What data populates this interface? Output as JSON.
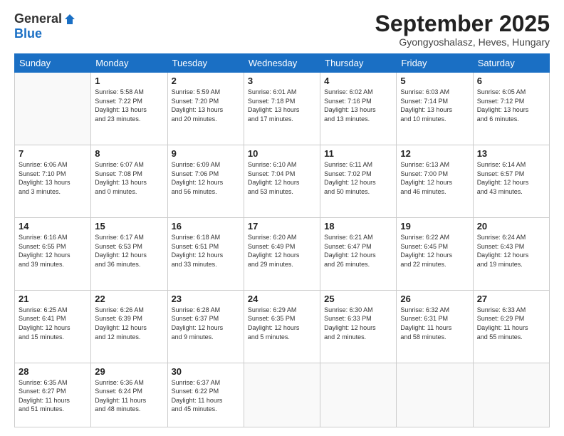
{
  "logo": {
    "general": "General",
    "blue": "Blue"
  },
  "header": {
    "month": "September 2025",
    "location": "Gyongyoshalasz, Heves, Hungary"
  },
  "days_of_week": [
    "Sunday",
    "Monday",
    "Tuesday",
    "Wednesday",
    "Thursday",
    "Friday",
    "Saturday"
  ],
  "weeks": [
    [
      {
        "day": "",
        "info": ""
      },
      {
        "day": "1",
        "info": "Sunrise: 5:58 AM\nSunset: 7:22 PM\nDaylight: 13 hours\nand 23 minutes."
      },
      {
        "day": "2",
        "info": "Sunrise: 5:59 AM\nSunset: 7:20 PM\nDaylight: 13 hours\nand 20 minutes."
      },
      {
        "day": "3",
        "info": "Sunrise: 6:01 AM\nSunset: 7:18 PM\nDaylight: 13 hours\nand 17 minutes."
      },
      {
        "day": "4",
        "info": "Sunrise: 6:02 AM\nSunset: 7:16 PM\nDaylight: 13 hours\nand 13 minutes."
      },
      {
        "day": "5",
        "info": "Sunrise: 6:03 AM\nSunset: 7:14 PM\nDaylight: 13 hours\nand 10 minutes."
      },
      {
        "day": "6",
        "info": "Sunrise: 6:05 AM\nSunset: 7:12 PM\nDaylight: 13 hours\nand 6 minutes."
      }
    ],
    [
      {
        "day": "7",
        "info": "Sunrise: 6:06 AM\nSunset: 7:10 PM\nDaylight: 13 hours\nand 3 minutes."
      },
      {
        "day": "8",
        "info": "Sunrise: 6:07 AM\nSunset: 7:08 PM\nDaylight: 13 hours\nand 0 minutes."
      },
      {
        "day": "9",
        "info": "Sunrise: 6:09 AM\nSunset: 7:06 PM\nDaylight: 12 hours\nand 56 minutes."
      },
      {
        "day": "10",
        "info": "Sunrise: 6:10 AM\nSunset: 7:04 PM\nDaylight: 12 hours\nand 53 minutes."
      },
      {
        "day": "11",
        "info": "Sunrise: 6:11 AM\nSunset: 7:02 PM\nDaylight: 12 hours\nand 50 minutes."
      },
      {
        "day": "12",
        "info": "Sunrise: 6:13 AM\nSunset: 7:00 PM\nDaylight: 12 hours\nand 46 minutes."
      },
      {
        "day": "13",
        "info": "Sunrise: 6:14 AM\nSunset: 6:57 PM\nDaylight: 12 hours\nand 43 minutes."
      }
    ],
    [
      {
        "day": "14",
        "info": "Sunrise: 6:16 AM\nSunset: 6:55 PM\nDaylight: 12 hours\nand 39 minutes."
      },
      {
        "day": "15",
        "info": "Sunrise: 6:17 AM\nSunset: 6:53 PM\nDaylight: 12 hours\nand 36 minutes."
      },
      {
        "day": "16",
        "info": "Sunrise: 6:18 AM\nSunset: 6:51 PM\nDaylight: 12 hours\nand 33 minutes."
      },
      {
        "day": "17",
        "info": "Sunrise: 6:20 AM\nSunset: 6:49 PM\nDaylight: 12 hours\nand 29 minutes."
      },
      {
        "day": "18",
        "info": "Sunrise: 6:21 AM\nSunset: 6:47 PM\nDaylight: 12 hours\nand 26 minutes."
      },
      {
        "day": "19",
        "info": "Sunrise: 6:22 AM\nSunset: 6:45 PM\nDaylight: 12 hours\nand 22 minutes."
      },
      {
        "day": "20",
        "info": "Sunrise: 6:24 AM\nSunset: 6:43 PM\nDaylight: 12 hours\nand 19 minutes."
      }
    ],
    [
      {
        "day": "21",
        "info": "Sunrise: 6:25 AM\nSunset: 6:41 PM\nDaylight: 12 hours\nand 15 minutes."
      },
      {
        "day": "22",
        "info": "Sunrise: 6:26 AM\nSunset: 6:39 PM\nDaylight: 12 hours\nand 12 minutes."
      },
      {
        "day": "23",
        "info": "Sunrise: 6:28 AM\nSunset: 6:37 PM\nDaylight: 12 hours\nand 9 minutes."
      },
      {
        "day": "24",
        "info": "Sunrise: 6:29 AM\nSunset: 6:35 PM\nDaylight: 12 hours\nand 5 minutes."
      },
      {
        "day": "25",
        "info": "Sunrise: 6:30 AM\nSunset: 6:33 PM\nDaylight: 12 hours\nand 2 minutes."
      },
      {
        "day": "26",
        "info": "Sunrise: 6:32 AM\nSunset: 6:31 PM\nDaylight: 11 hours\nand 58 minutes."
      },
      {
        "day": "27",
        "info": "Sunrise: 6:33 AM\nSunset: 6:29 PM\nDaylight: 11 hours\nand 55 minutes."
      }
    ],
    [
      {
        "day": "28",
        "info": "Sunrise: 6:35 AM\nSunset: 6:27 PM\nDaylight: 11 hours\nand 51 minutes."
      },
      {
        "day": "29",
        "info": "Sunrise: 6:36 AM\nSunset: 6:24 PM\nDaylight: 11 hours\nand 48 minutes."
      },
      {
        "day": "30",
        "info": "Sunrise: 6:37 AM\nSunset: 6:22 PM\nDaylight: 11 hours\nand 45 minutes."
      },
      {
        "day": "",
        "info": ""
      },
      {
        "day": "",
        "info": ""
      },
      {
        "day": "",
        "info": ""
      },
      {
        "day": "",
        "info": ""
      }
    ]
  ]
}
